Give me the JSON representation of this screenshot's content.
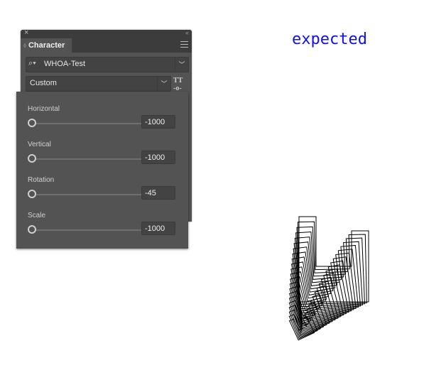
{
  "panel": {
    "tab_label": "Character",
    "font_family": "WHOA-Test",
    "font_style": "Custom",
    "icons": [
      "close-icon",
      "collapse-icon",
      "panel-menu-icon",
      "search-icon",
      "chevron-down-icon",
      "variable-font-icon"
    ]
  },
  "sliders": [
    {
      "label": "Horizontal",
      "value": "-1000"
    },
    {
      "label": "Vertical",
      "value": "-1000"
    },
    {
      "label": "Rotation",
      "value": "-45"
    },
    {
      "label": "Scale",
      "value": "-1000"
    }
  ],
  "preview": {
    "title": "expected",
    "title_color": "#1010ee"
  }
}
